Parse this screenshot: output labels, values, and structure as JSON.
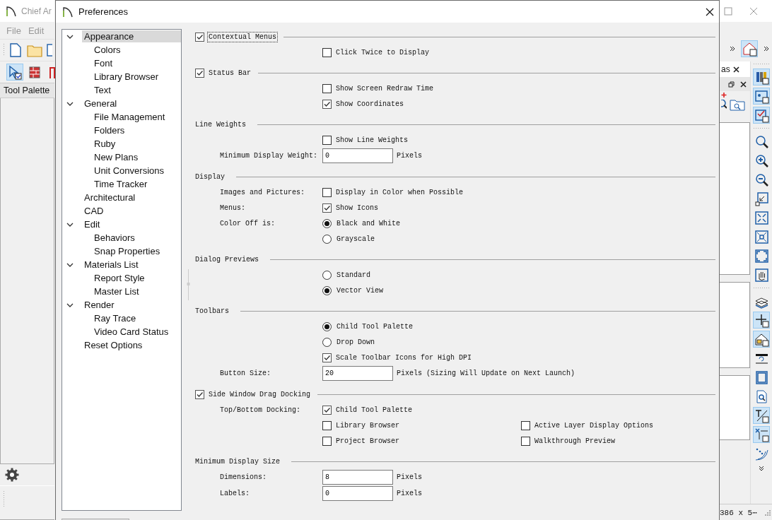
{
  "app": {
    "title": "Chief Ar",
    "menu": [
      "File",
      "Edit"
    ],
    "palette_tab": "Tool Palette",
    "right_tab": "as",
    "status": "386 x 5⋯"
  },
  "left_tools": [
    {
      "selected": true
    },
    {
      "selected": false
    },
    {
      "selected": false
    }
  ],
  "right_tools": [
    {
      "selected": true
    },
    {
      "selected": true
    },
    {
      "selected": true
    },
    {
      "selected": false
    },
    {
      "selected": false
    },
    {
      "selected": false
    },
    {
      "selected": false
    },
    {
      "selected": false
    },
    {
      "selected": false
    },
    {
      "selected": false
    },
    {
      "selected": false
    },
    {
      "selected": false
    },
    {
      "selected": true
    },
    {
      "selected": true
    },
    {
      "selected": false
    },
    {
      "selected": false
    },
    {
      "selected": false
    },
    {
      "selected": true
    },
    {
      "selected": true
    },
    {
      "selected": false
    }
  ],
  "dialog": {
    "title": "Preferences"
  },
  "tree": [
    {
      "label": "Appearance",
      "selected": true,
      "expanded": true,
      "children": [
        {
          "label": "Colors",
          "selected": false
        },
        {
          "label": "Font",
          "selected": false
        },
        {
          "label": "Library Browser",
          "selected": false
        },
        {
          "label": "Text",
          "selected": false
        }
      ]
    },
    {
      "label": "General",
      "selected": false,
      "expanded": true,
      "children": [
        {
          "label": "File Management",
          "selected": false
        },
        {
          "label": "Folders",
          "selected": false
        },
        {
          "label": "Ruby",
          "selected": false
        },
        {
          "label": "New Plans",
          "selected": false
        },
        {
          "label": "Unit Conversions",
          "selected": false
        },
        {
          "label": "Time Tracker",
          "selected": false
        }
      ]
    },
    {
      "label": "Architectural",
      "selected": false
    },
    {
      "label": "CAD",
      "selected": false
    },
    {
      "label": "Edit",
      "selected": false,
      "expanded": true,
      "children": [
        {
          "label": "Behaviors",
          "selected": false
        },
        {
          "label": "Snap Properties",
          "selected": false
        }
      ]
    },
    {
      "label": "Materials List",
      "selected": false,
      "expanded": true,
      "children": [
        {
          "label": "Report Style",
          "selected": false
        },
        {
          "label": "Master List",
          "selected": false
        }
      ]
    },
    {
      "label": "Render",
      "selected": false,
      "expanded": true,
      "children": [
        {
          "label": "Ray Trace",
          "selected": false
        },
        {
          "label": "Video Card Status",
          "selected": false
        }
      ]
    },
    {
      "label": "Reset Options",
      "selected": false
    }
  ],
  "sections": [
    {
      "kind": "checkbox",
      "label": "Contextual Menus",
      "checked": true,
      "focused": true,
      "rows": [
        {
          "controls": [
            {
              "kind": "checkbox",
              "label": "Click Twice to Display",
              "checked": false
            }
          ]
        }
      ]
    },
    {
      "kind": "checkbox",
      "label": "Status Bar",
      "checked": true,
      "focused": false,
      "rows": [
        {
          "controls": [
            {
              "kind": "checkbox",
              "label": "Show Screen Redraw Time",
              "checked": false
            }
          ]
        },
        {
          "controls": [
            {
              "kind": "checkbox",
              "label": "Show Coordinates",
              "checked": true
            }
          ]
        }
      ]
    },
    {
      "kind": "plain",
      "label": "Line Weights",
      "rows": [
        {
          "controls": [
            {
              "kind": "checkbox",
              "label": "Show Line Weights",
              "checked": false
            }
          ]
        },
        {
          "label": "Minimum Display Weight:",
          "controls": [
            {
              "kind": "input",
              "value": "0",
              "unit": "Pixels"
            }
          ]
        }
      ]
    },
    {
      "kind": "plain",
      "label": "Display",
      "rows": [
        {
          "label": "Images and Pictures:",
          "controls": [
            {
              "kind": "checkbox",
              "label": "Display in Color when Possible",
              "checked": false
            }
          ]
        },
        {
          "label": "Menus:",
          "controls": [
            {
              "kind": "checkbox",
              "label": "Show Icons",
              "checked": true
            }
          ]
        },
        {
          "label": "Color Off is:",
          "controls": [
            {
              "kind": "radio",
              "label": "Black and White",
              "selected": true
            }
          ]
        },
        {
          "controls": [
            {
              "kind": "radio",
              "label": "Grayscale",
              "selected": false
            }
          ]
        }
      ]
    },
    {
      "kind": "plain",
      "label": "Dialog Previews",
      "rows": [
        {
          "controls": [
            {
              "kind": "radio",
              "label": "Standard",
              "selected": false
            }
          ]
        },
        {
          "controls": [
            {
              "kind": "radio",
              "label": "Vector View",
              "selected": true
            }
          ]
        }
      ]
    },
    {
      "kind": "plain",
      "label": "Toolbars",
      "rows": [
        {
          "controls": [
            {
              "kind": "radio",
              "label": "Child Tool Palette",
              "selected": true
            }
          ]
        },
        {
          "controls": [
            {
              "kind": "radio",
              "label": "Drop Down",
              "selected": false
            }
          ]
        },
        {
          "controls": [
            {
              "kind": "checkbox",
              "label": "Scale Toolbar Icons for High DPI",
              "checked": true
            }
          ]
        },
        {
          "label": "Button Size:",
          "controls": [
            {
              "kind": "input",
              "value": "20",
              "unit": "Pixels (Sizing Will Update on Next Launch)"
            }
          ]
        }
      ]
    },
    {
      "kind": "checkbox",
      "label": "Side Window Drag Docking",
      "checked": true,
      "focused": false,
      "rows": [
        {
          "label": "Top/Bottom Docking:",
          "controls": [
            {
              "kind": "checkbox",
              "label": "Child Tool Palette",
              "checked": true
            }
          ]
        },
        {
          "controls": [
            {
              "kind": "checkbox",
              "label": "Library Browser",
              "checked": false
            },
            {
              "kind": "checkbox",
              "label": "Active Layer Display Options",
              "checked": false
            }
          ]
        },
        {
          "controls": [
            {
              "kind": "checkbox",
              "label": "Project Browser",
              "checked": false
            },
            {
              "kind": "checkbox",
              "label": "Walkthrough Preview",
              "checked": false
            }
          ]
        }
      ]
    },
    {
      "kind": "plain",
      "label": "Minimum Display Size",
      "rows": [
        {
          "label": "Dimensions:",
          "controls": [
            {
              "kind": "input",
              "value": "8",
              "unit": "Pixels"
            }
          ]
        },
        {
          "label": "Labels:",
          "controls": [
            {
              "kind": "input",
              "value": "0",
              "unit": "Pixels"
            }
          ]
        }
      ]
    }
  ]
}
